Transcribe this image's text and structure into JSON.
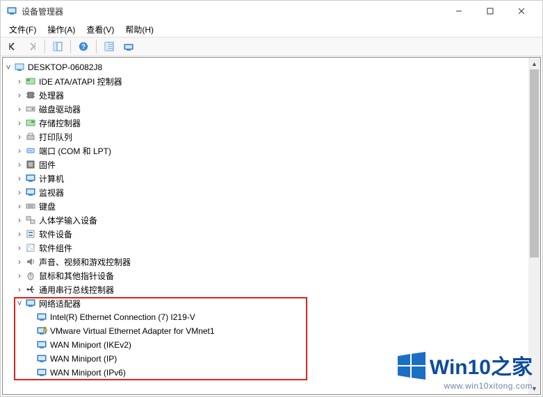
{
  "window": {
    "title": "设备管理器"
  },
  "menu": {
    "file": "文件(F)",
    "action": "操作(A)",
    "view": "查看(V)",
    "help": "帮助(H)"
  },
  "tree": {
    "root": "DESKTOP-06082J8",
    "categories": {
      "ide": "IDE ATA/ATAPI 控制器",
      "cpu": "处理器",
      "disk": "磁盘驱动器",
      "storage": "存储控制器",
      "print": "打印队列",
      "ports": "端口 (COM 和 LPT)",
      "firmware": "固件",
      "computer": "计算机",
      "monitor": "监视器",
      "keyboard": "键盘",
      "hid": "人体学输入设备",
      "swdev": "软件设备",
      "swcomp": "软件组件",
      "audio": "声音、视频和游戏控制器",
      "mouse": "鼠标和其他指针设备",
      "usb": "通用串行总线控制器",
      "network": "网络适配器"
    },
    "network_children": {
      "intel": "Intel(R) Ethernet Connection (7) I219-V",
      "vmnet1": "VMware Virtual Ethernet Adapter for VMnet1",
      "ikev2": "WAN Miniport (IKEv2)",
      "ip": "WAN Miniport (IP)",
      "ipv6": "WAN Miniport (IPv6)"
    }
  },
  "watermark": {
    "brand_en": "Win10",
    "brand_cn": "之家",
    "url": "www.win10xitong.com"
  }
}
